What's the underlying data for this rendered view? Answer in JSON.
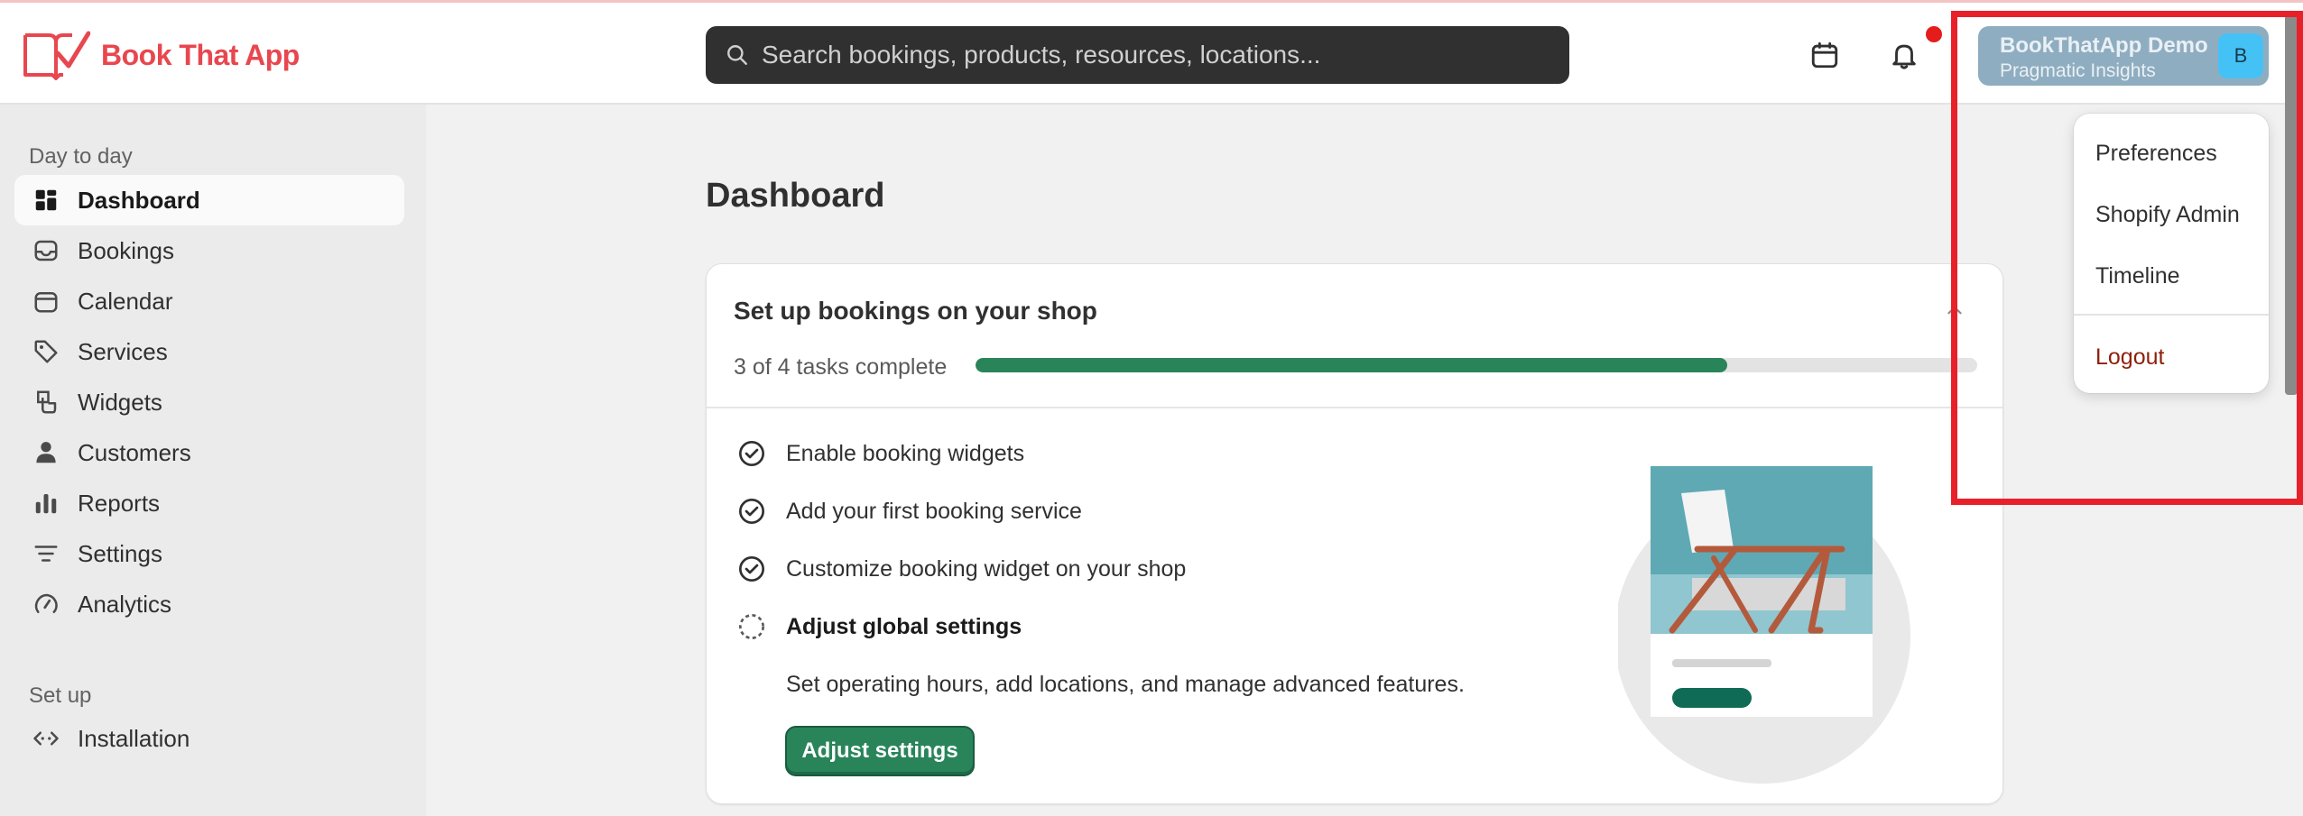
{
  "app": {
    "name": "Book That App",
    "brand_color": "#e8474f"
  },
  "search": {
    "placeholder": "Search bookings, products, resources, locations..."
  },
  "header": {
    "calendar_icon": "calendar-icon",
    "notification_icon": "bell-icon",
    "has_notification": true
  },
  "user": {
    "name": "BookThatApp Demo",
    "subtitle": "Pragmatic Insights",
    "initial": "B"
  },
  "user_menu": {
    "items": [
      {
        "label": "Preferences"
      },
      {
        "label": "Shopify Admin"
      },
      {
        "label": "Timeline"
      }
    ],
    "logout_label": "Logout"
  },
  "sidebar": {
    "section_day": "Day to day",
    "items": [
      {
        "label": "Dashboard",
        "icon": "dashboard-icon",
        "active": true
      },
      {
        "label": "Bookings",
        "icon": "inbox-icon"
      },
      {
        "label": "Calendar",
        "icon": "calendar-icon"
      },
      {
        "label": "Services",
        "icon": "tag-icon"
      },
      {
        "label": "Widgets",
        "icon": "widget-icon"
      },
      {
        "label": "Customers",
        "icon": "person-icon"
      },
      {
        "label": "Reports",
        "icon": "bar-chart-icon"
      },
      {
        "label": "Settings",
        "icon": "settings-lines-icon"
      },
      {
        "label": "Analytics",
        "icon": "gauge-icon"
      }
    ],
    "section_setup": "Set up",
    "setup_items": [
      {
        "label": "Installation",
        "icon": "code-icon"
      }
    ]
  },
  "main": {
    "title": "Dashboard",
    "setup_card": {
      "title": "Set up bookings on your shop",
      "progress_text": "3 of 4 tasks complete",
      "progress_fraction": 0.75,
      "tasks": [
        {
          "label": "Enable booking widgets",
          "done": true
        },
        {
          "label": "Add your first booking service",
          "done": true
        },
        {
          "label": "Customize booking widget on your shop",
          "done": true
        },
        {
          "label": "Adjust global settings",
          "done": false
        }
      ],
      "pending_description": "Set operating hours, add locations, and manage advanced features.",
      "action_label": "Adjust settings",
      "accent_color": "#29845a"
    }
  }
}
